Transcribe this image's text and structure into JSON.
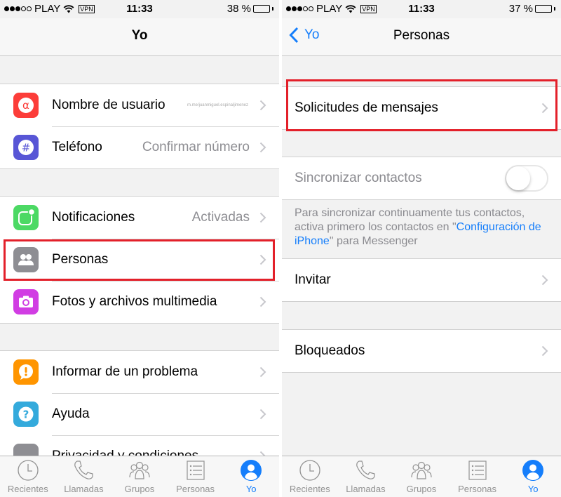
{
  "left": {
    "status": {
      "carrier": "PLAY",
      "vpn": "VPN",
      "time": "11:33",
      "battery": "38 %",
      "battery_level": 0.38,
      "signal_bars": 3,
      "signal_total": 5
    },
    "nav": {
      "title": "Yo"
    },
    "groups": [
      [
        {
          "label": "Nombre de usuario",
          "value": "m.me/juanmiguel.espinaljimenez",
          "icon": "at-icon",
          "color": "#fc3d39"
        },
        {
          "label": "Teléfono",
          "value": "Confirmar número",
          "icon": "hash-icon",
          "color": "#5856d6"
        }
      ],
      [
        {
          "label": "Notificaciones",
          "value": "Activadas",
          "icon": "notification-icon",
          "color": "#4cd964"
        },
        {
          "label": "Personas",
          "value": "",
          "icon": "people-icon",
          "color": "#8e8e93",
          "highlighted": true
        },
        {
          "label": "Fotos y archivos multimedia",
          "value": "",
          "icon": "camera-icon",
          "color": "#d13de3"
        }
      ],
      [
        {
          "label": "Informar de un problema",
          "value": "",
          "icon": "alert-icon",
          "color": "#ff9500"
        },
        {
          "label": "Ayuda",
          "value": "",
          "icon": "help-icon",
          "color": "#34aadc"
        },
        {
          "label": "Privacidad y condiciones",
          "value": "",
          "icon": "privacy-icon",
          "color": "#8e8e93"
        }
      ]
    ]
  },
  "right": {
    "status": {
      "carrier": "PLAY",
      "vpn": "VPN",
      "time": "11:33",
      "battery": "37 %",
      "battery_level": 0.37,
      "signal_bars": 3,
      "signal_total": 5
    },
    "nav": {
      "back_label": "Yo",
      "title": "Personas"
    },
    "message_requests": {
      "label": "Solicitudes de mensajes",
      "highlighted": true
    },
    "sync": {
      "label": "Sincronizar contactos",
      "enabled": false,
      "note_before": "Para sincronizar continuamente tus contactos, activa primero los contactos en \"",
      "note_link": "Configuración de iPhone",
      "note_after": "\" para Messenger"
    },
    "invite": {
      "label": "Invitar"
    },
    "blocked": {
      "label": "Bloqueados"
    }
  },
  "tabbar": {
    "items": [
      {
        "label": "Recientes",
        "icon": "clock-icon"
      },
      {
        "label": "Llamadas",
        "icon": "phone-icon"
      },
      {
        "label": "Grupos",
        "icon": "groups-icon"
      },
      {
        "label": "Personas",
        "icon": "list-icon"
      },
      {
        "label": "Yo",
        "icon": "profile-icon",
        "active": true
      }
    ],
    "active_color": "#157efb"
  },
  "colors": {
    "accent": "#157efb",
    "highlight": "#e3202a"
  }
}
